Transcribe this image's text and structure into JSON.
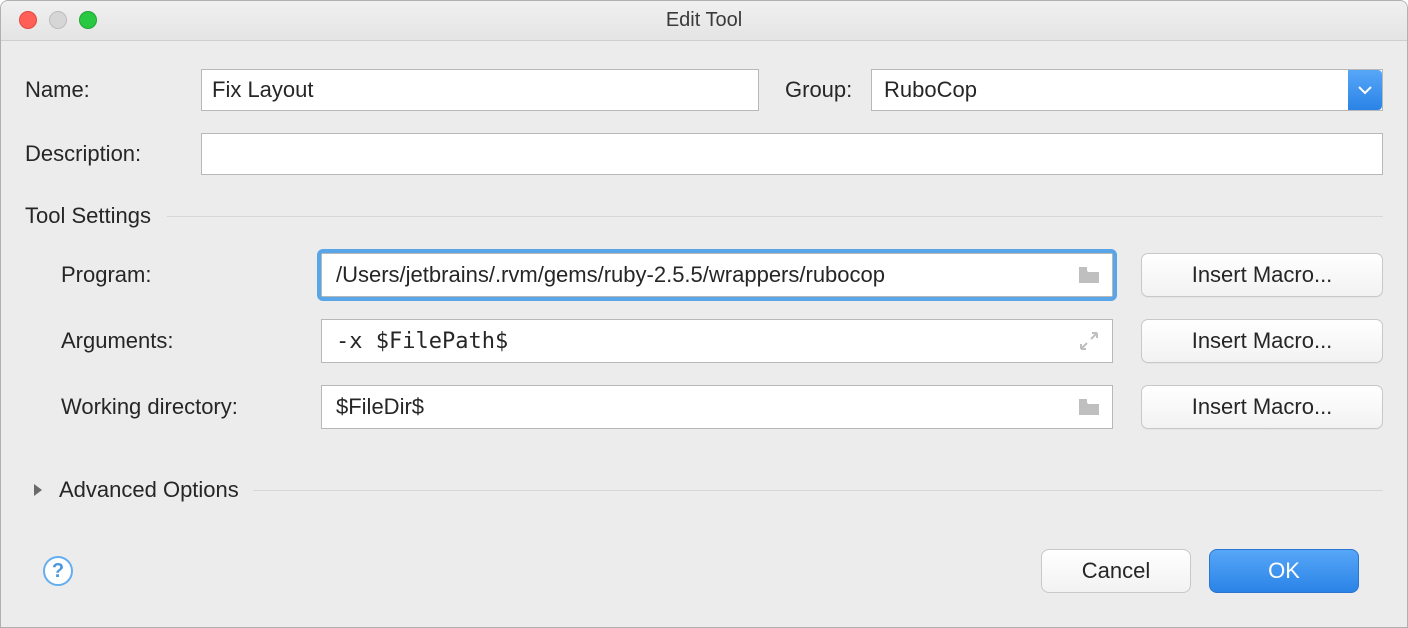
{
  "window": {
    "title": "Edit Tool"
  },
  "labels": {
    "name": "Name:",
    "group": "Group:",
    "description": "Description:",
    "tool_settings": "Tool Settings",
    "program": "Program:",
    "arguments": "Arguments:",
    "working_directory": "Working directory:",
    "advanced_options": "Advanced Options"
  },
  "fields": {
    "name": "Fix Layout",
    "group": "RuboCop",
    "description": "",
    "program": "/Users/jetbrains/.rvm/gems/ruby-2.5.5/wrappers/rubocop",
    "arguments": "-x $FilePath$",
    "working_dir": "$FileDir$"
  },
  "buttons": {
    "insert_macro": "Insert Macro...",
    "cancel": "Cancel",
    "ok": "OK",
    "help": "?"
  }
}
